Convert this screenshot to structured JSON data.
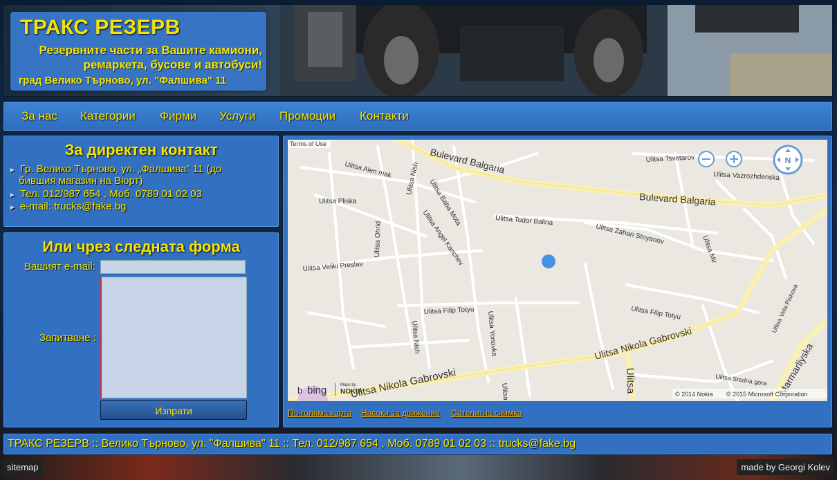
{
  "header": {
    "title": "ТРАКС РЕЗЕРВ",
    "subtitle_line1": "Резервните части за Вашите камиони,",
    "subtitle_line2": "ремаркета, бусове и автобуси!",
    "address": "град Велико Търново, ул. \"Фалшива\" 11"
  },
  "nav": {
    "items": [
      "За нас",
      "Категории",
      "Фирми",
      "Услуги",
      "Промоции",
      "Контакти"
    ]
  },
  "contact": {
    "title": "За директен контакт",
    "address_line1": "Гр. Велико Търново, ул. „Фалшива” 11 (до",
    "address_line2": "бившия магазин на Вюрт)",
    "phone": "Тел. 012/987 654 , Моб. 0789 01 02 03",
    "email": "e-mail: trucks@fake.bg"
  },
  "form": {
    "title": "Или чрез следната форма",
    "email_label": "Вашият e-mail:",
    "email_value": "",
    "message_label": "Запитване :",
    "message_value": "",
    "submit_label": "Изпрати"
  },
  "map": {
    "terms": "Terms of Use",
    "bing": "bing",
    "maps_by": "Maps by",
    "nokia": "NOKIA",
    "copyright_nokia": "© 2014 Nokia",
    "copyright_ms": "© 2015 Microsoft Corporation",
    "compass": "N",
    "streets": {
      "bulevard_balgaria": "Bulevard Balgaria",
      "alen_mak": "Ulitsa Alen mak",
      "nish": "Ulitsa Nish",
      "baba_mota": "Ulitsa Baba Mota",
      "pliska": "Ulitsa Pliska",
      "angel_kanchev": "Ulitsa Angel Kanchev",
      "ohrid": "Ulitsa Ohrid",
      "veliki_preslav": "Ulitsa Veliki Preslav",
      "todor_balina": "Ulitsa Todor Balina",
      "zahari_stoyanov": "Ulitsa Zahari Stoyanov",
      "tsvetarov": "Ulitsa Tsvetarov",
      "vazrozhdenska": "Ulitsa Vazrozhdenska",
      "mir": "Ulitsa Mir",
      "filip_totyu": "Ulitsa Filip Totyu",
      "yonovka": "Ulitsa Yonovka",
      "nikola_gabrovski": "Ulitsa Nikola Gabrovski",
      "ulitsa_short": "Ulitsa",
      "vela_piskova": "Ulitsa Vela Piskova",
      "sredna_gora": "Ulitsa Sredna gora",
      "marmarliyska": "Marmarliyska"
    },
    "links": [
      "По-голяма карта",
      "Насоки за движение",
      "Сателитна снимка"
    ]
  },
  "footer": {
    "text": "ТРАКС РЕЗЕРВ :: Велико Търново, ул. \"Фалшива\" 11 :: Тел. 012/987 654 , Моб. 0789 01 02 03 :: trucks@fake.bg"
  },
  "bottom": {
    "sitemap": "sitemap",
    "credit": "made by Georgi Kolev"
  }
}
